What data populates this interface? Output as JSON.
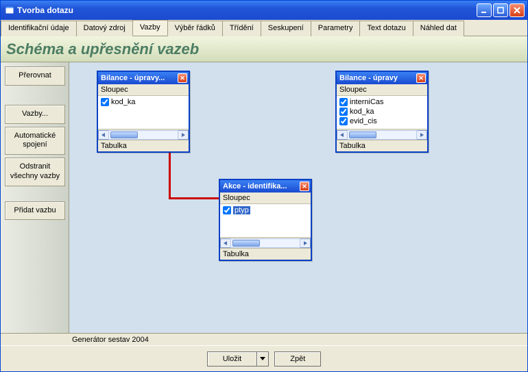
{
  "window": {
    "title": "Tvorba dotazu"
  },
  "tabs": [
    "Identifikační údaje",
    "Datový zdroj",
    "Vazby",
    "Výběr řádků",
    "Třídění",
    "Seskupení",
    "Parametry",
    "Text dotazu",
    "Náhled dat"
  ],
  "header": {
    "title": "Schéma a upřesnění vazeb"
  },
  "sidepanel": {
    "buttons": {
      "rearrange": "Přerovnat",
      "bonds": "Vazby...",
      "autojoin": "Automatické spojení",
      "removeall": "Odstranit všechny vazby",
      "addbond": "Přidat vazbu"
    }
  },
  "tables": {
    "colheader": "Sloupec",
    "footer": "Tabulka",
    "t1": {
      "title": "Bilance - úpravy...",
      "cols": [
        "kod_ka"
      ]
    },
    "t2": {
      "title": "Bilance - úpravy",
      "cols": [
        "interniCas",
        "kod_ka",
        "evid_cis"
      ]
    },
    "t3": {
      "title": "Akce - identifika...",
      "cols": [
        "ptyp"
      ],
      "selected": 0
    }
  },
  "status": "Generátor sestav 2004",
  "buttons": {
    "save": "Uložit",
    "back": "Zpět"
  }
}
